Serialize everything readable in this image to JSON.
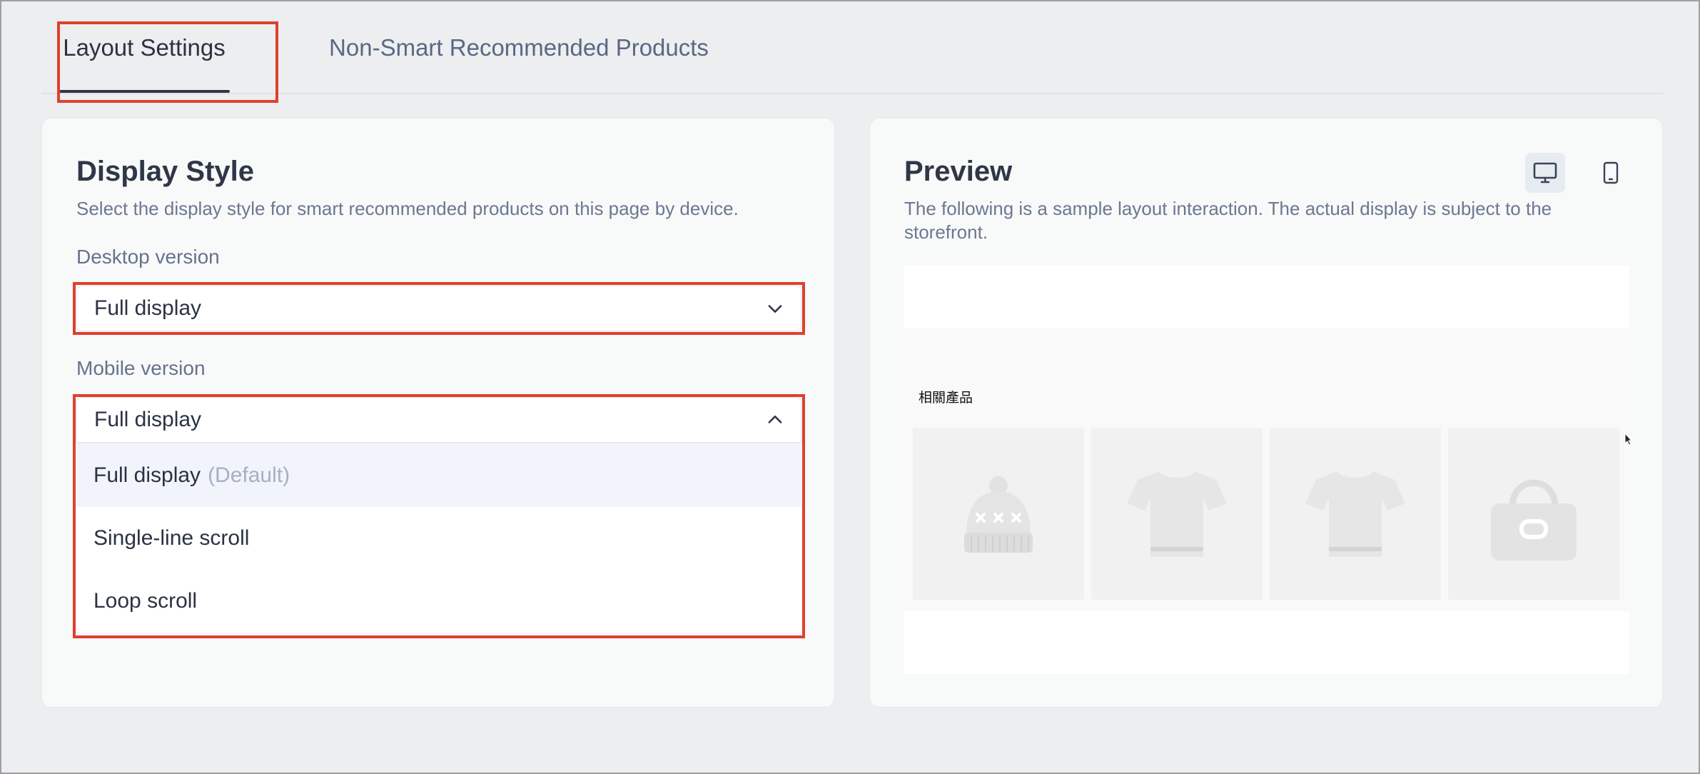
{
  "tabs": [
    {
      "label": "Layout Settings",
      "active": true
    },
    {
      "label": "Non-Smart Recommended Products",
      "active": false
    }
  ],
  "display_style": {
    "title": "Display Style",
    "description": "Select the display style for smart recommended products on this page by device.",
    "desktop": {
      "label": "Desktop version",
      "value": "Full display"
    },
    "mobile": {
      "label": "Mobile version",
      "value": "Full display",
      "options": [
        {
          "label": "Full display",
          "note": "(Default)",
          "selected": true
        },
        {
          "label": "Single-line scroll",
          "note": "",
          "selected": false
        },
        {
          "label": "Loop scroll",
          "note": "",
          "selected": false
        }
      ]
    }
  },
  "preview": {
    "title": "Preview",
    "description": "The following is a sample layout interaction. The actual display is subject to the storefront.",
    "section_heading": "相關產品",
    "device_buttons": [
      {
        "icon": "desktop-icon",
        "active": true
      },
      {
        "icon": "mobile-icon",
        "active": false
      }
    ],
    "products": [
      {
        "icon": "beanie-icon"
      },
      {
        "icon": "tshirt-icon"
      },
      {
        "icon": "tshirt-icon"
      },
      {
        "icon": "handbag-icon"
      }
    ]
  },
  "colors": {
    "highlight": "#e0402d",
    "background": "#edeef0",
    "card": "#f8f9f9",
    "selected_option": "#f1f4fa"
  }
}
